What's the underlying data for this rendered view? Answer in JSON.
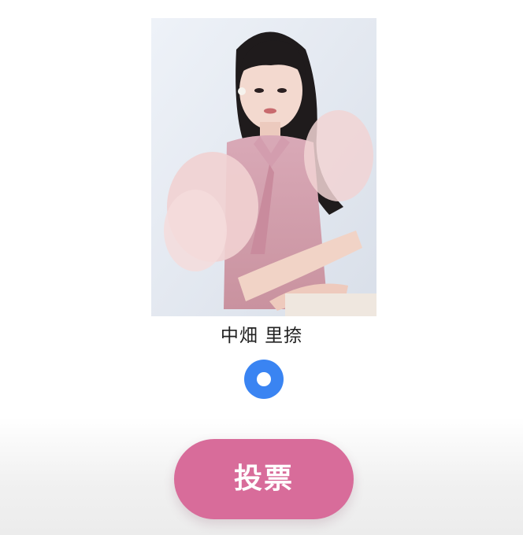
{
  "candidate": {
    "name": "中畑 里捺",
    "selected": true
  },
  "vote_button": {
    "label": "投票"
  },
  "colors": {
    "radio_accent": "#3a84f2",
    "vote_button_bg": "#d86c9a"
  }
}
